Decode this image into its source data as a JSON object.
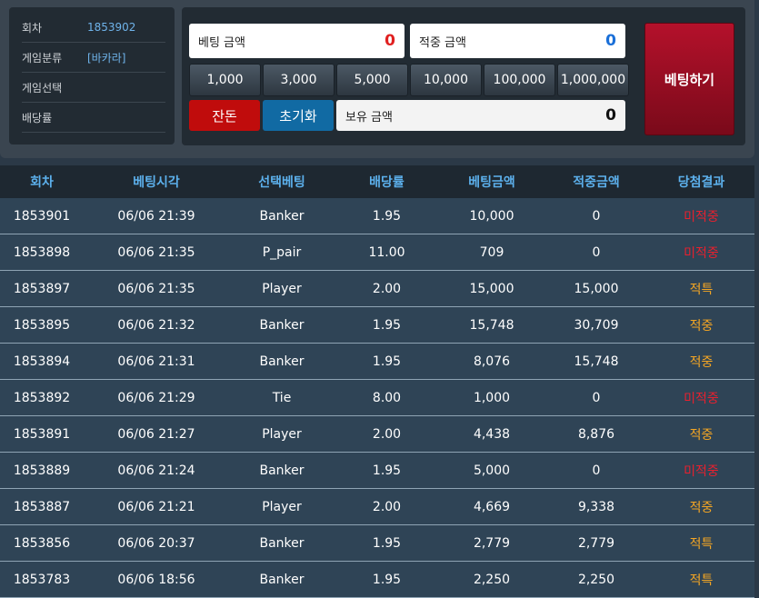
{
  "info": {
    "rows": [
      {
        "label": "회차",
        "value": "1853902"
      },
      {
        "label": "게임분류",
        "value": "[바카라]"
      },
      {
        "label": "게임선택",
        "value": ""
      },
      {
        "label": "배당률",
        "value": ""
      }
    ]
  },
  "bet_panel": {
    "bet_amount_label": "베팅 금액",
    "bet_amount_value": "0",
    "win_amount_label": "적중 금액",
    "win_amount_value": "0",
    "chips": [
      "1,000",
      "3,000",
      "5,000",
      "10,000",
      "100,000",
      "1,000,000"
    ],
    "change_label": "잔돈",
    "reset_label": "초기화",
    "balance_label": "보유 금액",
    "balance_value": "0",
    "bet_button_label": "베팅하기",
    "colors": {
      "bet_amount": "#e02020",
      "win_amount": "#1a6fd8"
    }
  },
  "table": {
    "headers": [
      "회차",
      "베팅시각",
      "선택베팅",
      "배당률",
      "베팅금액",
      "적중금액",
      "당첨결과"
    ],
    "rows": [
      [
        "1853901",
        "06/06 21:39",
        "Banker",
        "1.95",
        "10,000",
        "0",
        "미적중"
      ],
      [
        "1853898",
        "06/06 21:35",
        "P_pair",
        "11.00",
        "709",
        "0",
        "미적중"
      ],
      [
        "1853897",
        "06/06 21:35",
        "Player",
        "2.00",
        "15,000",
        "15,000",
        "적특"
      ],
      [
        "1853895",
        "06/06 21:32",
        "Banker",
        "1.95",
        "15,748",
        "30,709",
        "적중"
      ],
      [
        "1853894",
        "06/06 21:31",
        "Banker",
        "1.95",
        "8,076",
        "15,748",
        "적중"
      ],
      [
        "1853892",
        "06/06 21:29",
        "Tie",
        "8.00",
        "1,000",
        "0",
        "미적중"
      ],
      [
        "1853891",
        "06/06 21:27",
        "Player",
        "2.00",
        "4,438",
        "8,876",
        "적중"
      ],
      [
        "1853889",
        "06/06 21:24",
        "Banker",
        "1.95",
        "5,000",
        "0",
        "미적중"
      ],
      [
        "1853887",
        "06/06 21:21",
        "Player",
        "2.00",
        "4,669",
        "9,338",
        "적중"
      ],
      [
        "1853856",
        "06/06 20:37",
        "Banker",
        "1.95",
        "2,779",
        "2,779",
        "적특"
      ],
      [
        "1853783",
        "06/06 18:56",
        "Banker",
        "1.95",
        "2,250",
        "2,250",
        "적특"
      ]
    ]
  }
}
